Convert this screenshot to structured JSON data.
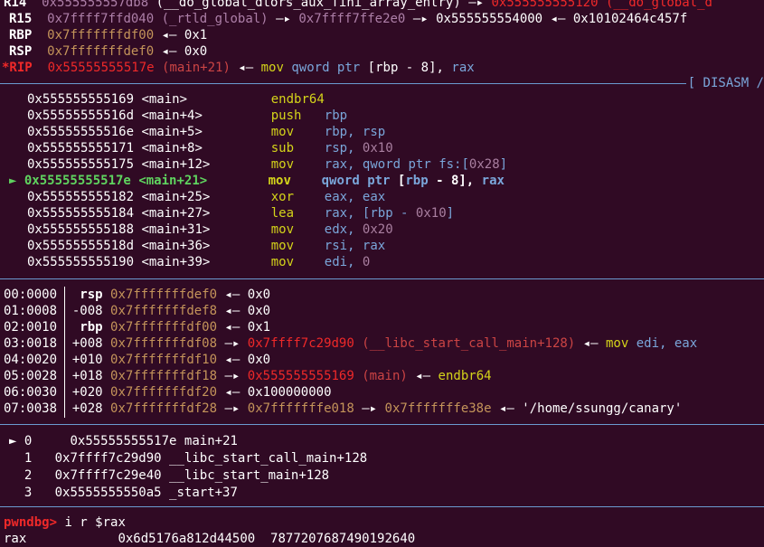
{
  "registers": [
    {
      "name": "R14",
      "value": "0x555555557db8",
      "desc": "(__do_global_dtors_aux_fini_array_entry)",
      "arrow": "—▸",
      "target": "0x555555555120",
      "target_desc": "(__do_global_d"
    },
    {
      "name": "R15",
      "value": "0x7ffff7ffd040",
      "desc": "(_rtld_global)",
      "arrow": "—▸",
      "target": "0x7ffff7ffe2e0",
      "arrow2": "—▸",
      "target2": "0x555555554000",
      "arrow3": "◂—",
      "target3": "0x10102464c457f"
    },
    {
      "name": "RBP",
      "value": "0x7fffffffdf00",
      "arrow": "◂—",
      "target": "0x1"
    },
    {
      "name": "RSP",
      "value": "0x7fffffffdef0",
      "arrow": "◂—",
      "target": "0x0"
    },
    {
      "name": "*RIP",
      "value": "0x55555555517e",
      "desc": "(main+21)",
      "arrow": "◂—",
      "instr": "mov",
      "operands_a": "qword ptr",
      "operands_b": "[rbp - 8],",
      "operands_c": "rax"
    }
  ],
  "disasm_header": "[ DISASM /",
  "disasm": [
    {
      "addr": "0x555555555169",
      "sym": "<main>",
      "op": "endbr64",
      "args": ""
    },
    {
      "addr": "0x55555555516d",
      "sym": "<main+4>",
      "op": "push",
      "args": "rbp"
    },
    {
      "addr": "0x55555555516e",
      "sym": "<main+5>",
      "op": "mov",
      "args": "rbp, rsp"
    },
    {
      "addr": "0x555555555171",
      "sym": "<main+8>",
      "op": "sub",
      "args": "rsp, 0x10"
    },
    {
      "addr": "0x555555555175",
      "sym": "<main+12>",
      "op": "mov",
      "args": "rax, qword ptr fs:[0x28]"
    },
    {
      "addr": "0x55555555517e",
      "sym": "<main+21>",
      "op": "mov",
      "args": "qword ptr [rbp - 8], rax",
      "current": true,
      "marker": "►"
    },
    {
      "addr": "0x555555555182",
      "sym": "<main+25>",
      "op": "xor",
      "args": "eax, eax"
    },
    {
      "addr": "0x555555555184",
      "sym": "<main+27>",
      "op": "lea",
      "args": "rax, [rbp - 0x10]"
    },
    {
      "addr": "0x555555555188",
      "sym": "<main+31>",
      "op": "mov",
      "args": "edx, 0x20"
    },
    {
      "addr": "0x55555555518d",
      "sym": "<main+36>",
      "op": "mov",
      "args": "rsi, rax"
    },
    {
      "addr": "0x555555555190",
      "sym": "<main+39>",
      "op": "mov",
      "args": "edi, 0"
    }
  ],
  "stack": [
    {
      "idx": "00:0000",
      "off": "rsp",
      "addr": "0x7fffffffdef0",
      "arrow": "◂—",
      "val": "0x0"
    },
    {
      "idx": "01:0008",
      "off": "-008",
      "addr": "0x7fffffffdef8",
      "arrow": "◂—",
      "val": "0x0"
    },
    {
      "idx": "02:0010",
      "off": "rbp",
      "addr": "0x7fffffffdf00",
      "arrow": "◂—",
      "val": "0x1"
    },
    {
      "idx": "03:0018",
      "off": "+008",
      "addr": "0x7fffffffdf08",
      "arrow": "—▸",
      "val": "0x7ffff7c29d90",
      "desc": "(__libc_start_call_main+128)",
      "arrow2": "◂—",
      "instr": "mov",
      "args": "edi, eax"
    },
    {
      "idx": "04:0020",
      "off": "+010",
      "addr": "0x7fffffffdf10",
      "arrow": "◂—",
      "val": "0x0"
    },
    {
      "idx": "05:0028",
      "off": "+018",
      "addr": "0x7fffffffdf18",
      "arrow": "—▸",
      "val": "0x555555555169",
      "desc": "(main)",
      "arrow2": "◂—",
      "instr": "endbr64"
    },
    {
      "idx": "06:0030",
      "off": "+020",
      "addr": "0x7fffffffdf20",
      "arrow": "◂—",
      "val": "0x100000000"
    },
    {
      "idx": "07:0038",
      "off": "+028",
      "addr": "0x7fffffffdf28",
      "arrow": "—▸",
      "val": "0x7fffffffe018",
      "arrow2": "—▸",
      "val2": "0x7fffffffe38e",
      "arrow3": "◂—",
      "str": "'/home/ssungg/canary'"
    }
  ],
  "backtrace": [
    {
      "marker": "►",
      "n": "0",
      "addr": "0x55555555517e",
      "sym": "main+21"
    },
    {
      "n": "1",
      "addr": "0x7ffff7c29d90",
      "sym": "__libc_start_call_main+128"
    },
    {
      "n": "2",
      "addr": "0x7ffff7c29e40",
      "sym": "__libc_start_main+128"
    },
    {
      "n": "3",
      "addr": "0x5555555550a5",
      "sym": "_start+37"
    }
  ],
  "prompt": "pwndbg>",
  "command": "i r $rax",
  "output": {
    "reg": "rax",
    "hex": "0x6d5176a812d44500",
    "dec": "7877207687490192640"
  },
  "colors": {
    "bg": "#300a24",
    "red": "#ef2929",
    "yellow": "#d4d41a",
    "blue": "#7aa6da",
    "green": "#4ec94e",
    "magenta": "#ad7fa8"
  }
}
